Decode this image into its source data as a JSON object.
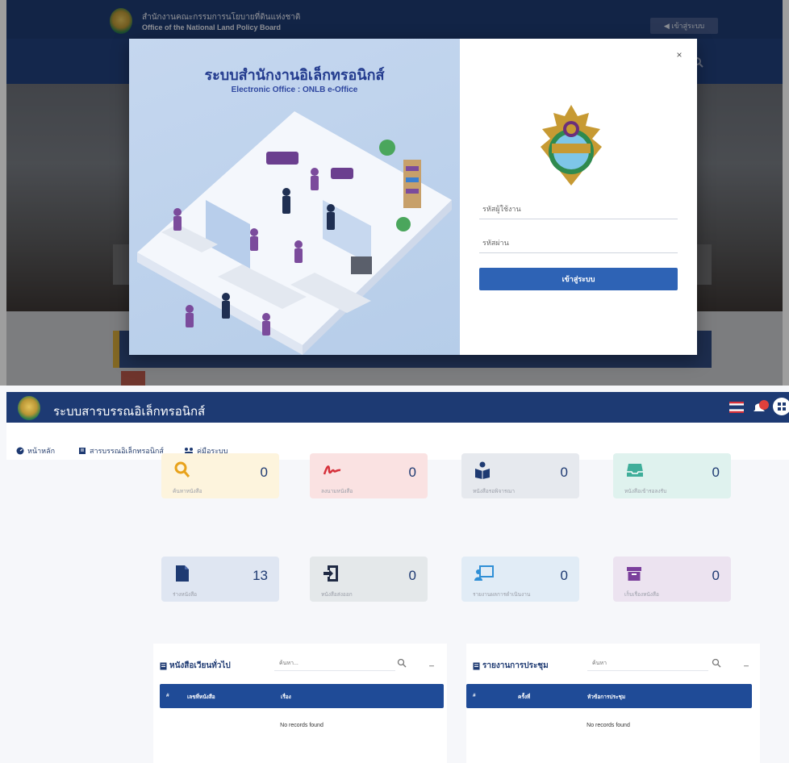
{
  "login_screen": {
    "header": {
      "org_name_th": "สำนักงานคณะกรรมการนโยบายที่ดินแห่งชาติ",
      "org_name_en": "Office of the National Land Policy Board",
      "login_button": "◀ เข้าสู่ระบบ"
    },
    "modal": {
      "title_th": "ระบบสำนักงานอิเล็กทรอนิกส์",
      "title_en": "Electronic Office : ONLB e-Office",
      "close_label": "×",
      "username_placeholder": "รหัสผู้ใช้งาน",
      "password_placeholder": "รหัสผ่าน",
      "submit_label": "เข้าสู่ระบบ"
    }
  },
  "dashboard": {
    "app_title": "ระบบสารบรรณอิเล็กทรอนิกส์",
    "menu": [
      {
        "label": "หน้าหลัก",
        "icon": "dashboard-icon"
      },
      {
        "label": "สารบรรณอิเล็กทรอนิกส์",
        "icon": "book-icon"
      },
      {
        "label": "คู่มือระบบ",
        "icon": "users-icon"
      }
    ],
    "cards": [
      {
        "label": "ค้นหาหนังสือ",
        "value": "0",
        "icon": "search-icon",
        "color": "#e8a21b",
        "bg": "#fdf4dd"
      },
      {
        "label": "ลงนามหนังสือ",
        "value": "0",
        "icon": "signature-icon",
        "color": "#d6313b",
        "bg": "#fae2e2"
      },
      {
        "label": "หนังสือรอพิจารณา",
        "value": "0",
        "icon": "reader-icon",
        "color": "#1e3a72",
        "bg": "#e6e9ee"
      },
      {
        "label": "หนังสือเข้ารอลงรับ",
        "value": "0",
        "icon": "inbox-icon",
        "color": "#3fae9a",
        "bg": "#dff2ee"
      },
      {
        "label": "ร่างหนังสือ",
        "value": "13",
        "icon": "file-icon",
        "color": "#1e3a72",
        "bg": "#dfe6f2"
      },
      {
        "label": "หนังสือส่งออก",
        "value": "0",
        "icon": "sign-in-icon",
        "color": "#1f2a44",
        "bg": "#e4e8ea"
      },
      {
        "label": "รายงานผลการดำเนินงาน",
        "value": "0",
        "icon": "presentation-icon",
        "color": "#2f8fd6",
        "bg": "#e1ecf6"
      },
      {
        "label": "เก็บเรื่องหนังสือ",
        "value": "0",
        "icon": "archive-icon",
        "color": "#7b3f9c",
        "bg": "#ece3f0"
      }
    ],
    "panels": [
      {
        "title": "หนังสือเวียนทั่วไป",
        "search_placeholder": "ค้นหา...",
        "columns": [
          "#",
          "เลขที่หนังสือ",
          "เรื่อง"
        ],
        "empty_text": "No records found"
      },
      {
        "title": "รายงานการประชุม",
        "search_placeholder": "ค้นหา",
        "columns": [
          "#",
          "ครั้งที่",
          "หัวข้อการประชุม"
        ],
        "empty_text": "No records found"
      }
    ]
  }
}
